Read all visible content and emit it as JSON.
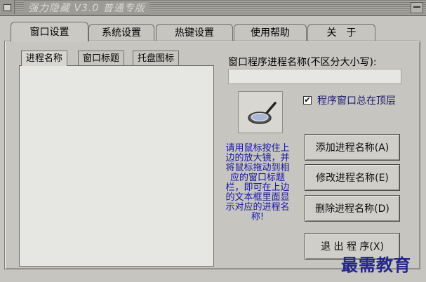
{
  "window": {
    "title": "强力隐藏 V3.0 普通专版"
  },
  "tabs": [
    {
      "label": "窗口设置"
    },
    {
      "label": "系统设置"
    },
    {
      "label": "热键设置"
    },
    {
      "label": "使用帮助"
    },
    {
      "label": "关　于"
    }
  ],
  "subtabs": [
    {
      "label": "进程名称"
    },
    {
      "label": "窗口标题"
    },
    {
      "label": "托盘图标"
    }
  ],
  "process": {
    "label": "窗口程序进程名称(不区分大小写):",
    "value": ""
  },
  "topmost": {
    "label": "程序窗口总在顶层",
    "checked": true
  },
  "help_text": "请用鼠标按住上边的放大镜，并将鼠标拖动到相应的窗口标题栏，即可在上边的文本框里面显示对应的进程名称!",
  "buttons": {
    "add": "添加进程名称(A)",
    "edit": "修改进程名称(E)",
    "delete": "删除进程名称(D)",
    "exit": "退 出 程 序(X)"
  },
  "watermark": "最需教育"
}
